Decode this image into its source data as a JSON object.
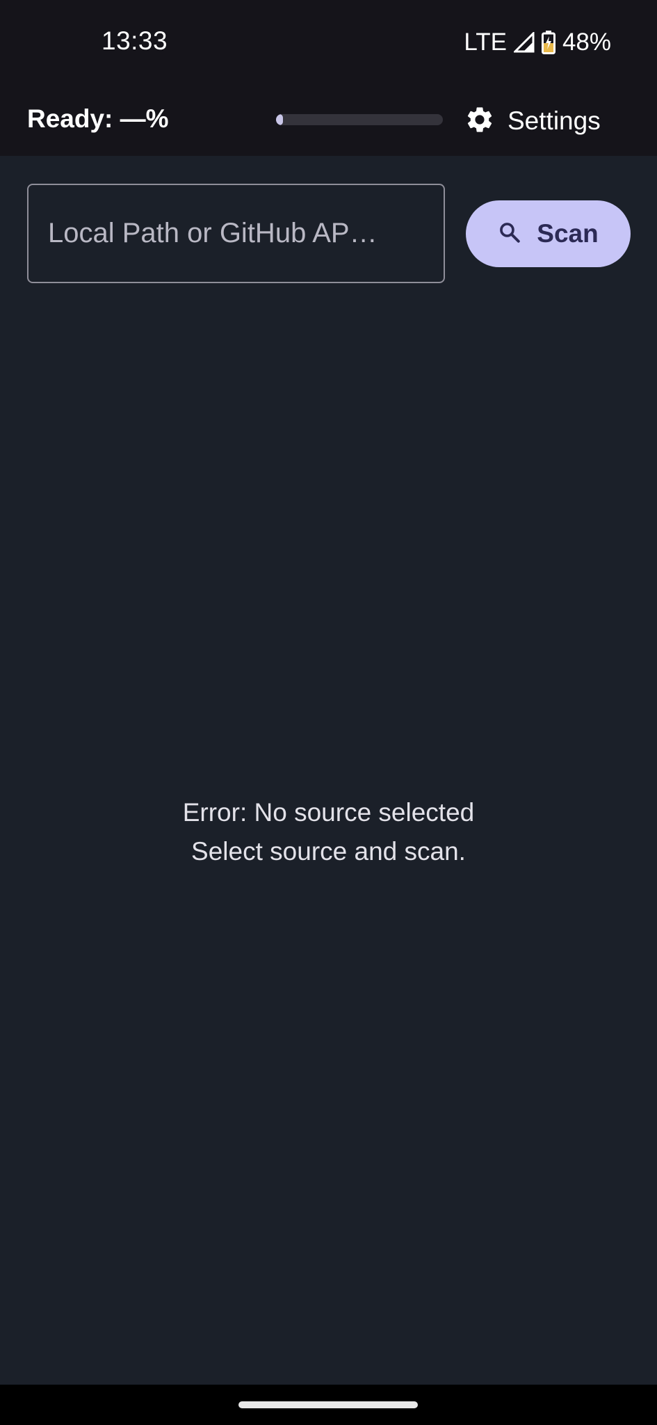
{
  "status_bar": {
    "time": "13:33",
    "network": "LTE",
    "battery": "48%",
    "icons": [
      "signal-icon",
      "battery-charging-icon"
    ]
  },
  "app_bar": {
    "status_label": "Ready: —%",
    "progress_fraction": 0.02,
    "settings_label": "Settings",
    "settings_icon": "gear-icon"
  },
  "search": {
    "placeholder": "Local Path or GitHub AP…",
    "value": ""
  },
  "scan_button": {
    "label": "Scan",
    "icon": "search-icon"
  },
  "message": {
    "line1": "Error: No source selected",
    "line2": "Select source and scan."
  },
  "colors": {
    "background": "#1b2029",
    "app_bar": "#15141a",
    "accent": "#c7c5f7",
    "on_accent": "#2c2a55"
  }
}
